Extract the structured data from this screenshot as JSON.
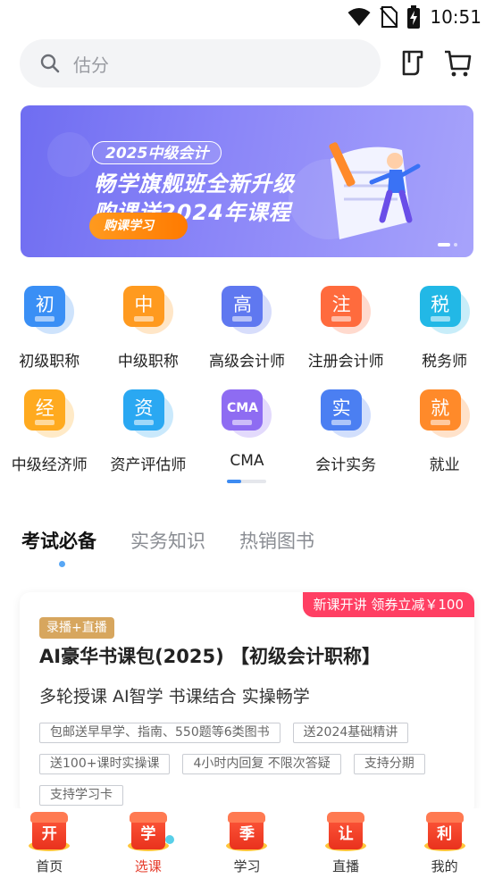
{
  "status_bar": {
    "time": "10:51",
    "icons": [
      "wifi-icon",
      "no-sim-icon",
      "battery-charging-icon"
    ]
  },
  "search": {
    "placeholder": "估分"
  },
  "header_icons": [
    "phone-icon",
    "cart-icon"
  ],
  "banner": {
    "pill": "2025中级会计",
    "line1": "畅学旗舰班全新升级",
    "line2": "购课送2024年课程",
    "button": "购课学习",
    "pages": 2,
    "active_page": 1
  },
  "categories": [
    {
      "char": "初",
      "label": "初级职称",
      "color": "#3a8ff5"
    },
    {
      "char": "中",
      "label": "中级职称",
      "color": "#ff9a1f"
    },
    {
      "char": "高",
      "label": "高级会计师",
      "color": "#5f78f0"
    },
    {
      "char": "注",
      "label": "注册会计师",
      "color": "#ff6b3d"
    },
    {
      "char": "税",
      "label": "税务师",
      "color": "#22b8e6"
    },
    {
      "char": "经",
      "label": "中级经济师",
      "color": "#ffaa1f"
    },
    {
      "char": "资",
      "label": "资产评估师",
      "color": "#2aa8f2"
    },
    {
      "char": "CMA",
      "label": "CMA",
      "color": "#8e6cf2"
    },
    {
      "char": "实",
      "label": "会计实务",
      "color": "#4b7ff2"
    },
    {
      "char": "就",
      "label": "就业",
      "color": "#ff8a2a"
    }
  ],
  "category_pager": {
    "pages": 2,
    "active_page": 1
  },
  "tabs": [
    {
      "label": "考试必备",
      "active": true
    },
    {
      "label": "实务知识",
      "active": false
    },
    {
      "label": "热销图书",
      "active": false
    }
  ],
  "course_card": {
    "promo": "新课开讲 领券立减￥100",
    "tag": "录播+直播",
    "title": "AI豪华书课包(2025) 【初级会计职称】",
    "subtitle": "多轮授课 AI智学 书课结合 实操畅学",
    "features": [
      "包邮送早早学、指南、550题等6类图书",
      "送2024基础精讲",
      "送100+课时实操课",
      "4小时内回复 不限次答疑",
      "支持分期",
      "支持学习卡"
    ]
  },
  "bottom_nav": [
    {
      "char": "开",
      "label": "首页",
      "active": false
    },
    {
      "char": "学",
      "label": "选课",
      "active": true
    },
    {
      "char": "季",
      "label": "学习",
      "active": false
    },
    {
      "char": "让",
      "label": "直播",
      "active": false
    },
    {
      "char": "利",
      "label": "我的",
      "active": false
    }
  ],
  "colors": {
    "accent": "#3d8bf2",
    "promo": "#ff3f63",
    "tag_gold": "#d7a65e",
    "nav_active": "#e63b2a"
  }
}
